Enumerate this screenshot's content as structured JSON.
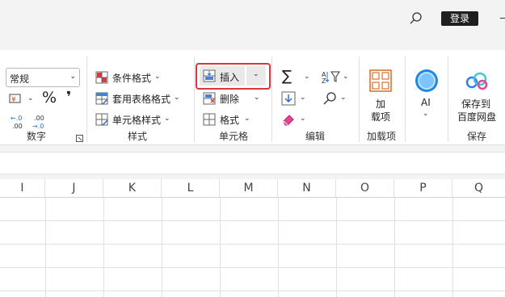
{
  "titlebar": {
    "login_label": "登录"
  },
  "ribbon": {
    "number": {
      "format_value": "常规",
      "percent_symbol": "%",
      "comma_symbol": "❜",
      "increase_decimal": "←.0\n.00",
      "decrease_decimal": ".00\n→.0",
      "group_label": "数字"
    },
    "styles": {
      "conditional_format": "条件格式",
      "format_as_table": "套用表格格式",
      "cell_styles": "单元格样式",
      "group_label": "样式"
    },
    "cells": {
      "insert": "插入",
      "delete": "删除",
      "format": "格式",
      "group_label": "单元格"
    },
    "editing": {
      "sigma": "∑",
      "group_label": "编辑"
    },
    "addins": {
      "line1": "加",
      "line2": "载项",
      "group_label": "加载项"
    },
    "ai": {
      "label": "AI"
    },
    "save": {
      "line1": "保存到",
      "line2": "百度网盘",
      "group_label": "保存"
    }
  },
  "sheet": {
    "columns": [
      "I",
      "J",
      "K",
      "L",
      "M",
      "N",
      "O",
      "P",
      "Q"
    ]
  },
  "colors": {
    "highlight": "#d9363e",
    "ai_blue": "#1e88e5",
    "baidu_blue": "#2f80ed"
  }
}
